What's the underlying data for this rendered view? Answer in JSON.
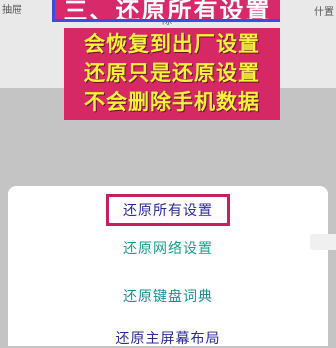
{
  "background": {
    "top_left_text": "抽屉",
    "top_right_text": "什置",
    "under_text": "除"
  },
  "banner": {
    "title": "三、还原所有设置",
    "lines": [
      "会恢复到出厂设置",
      "还原只是还原设置",
      "不会删除手机数据"
    ]
  },
  "sheet": {
    "options": [
      {
        "label": "还原所有设置"
      },
      {
        "label": "还原网络设置"
      },
      {
        "label": "还原键盘词典"
      },
      {
        "label": "还原主屏幕布局"
      }
    ]
  },
  "colors": {
    "banner_bg": "#d62864",
    "banner_text": "#f6f23a",
    "highlight_border": "#c3235d"
  }
}
